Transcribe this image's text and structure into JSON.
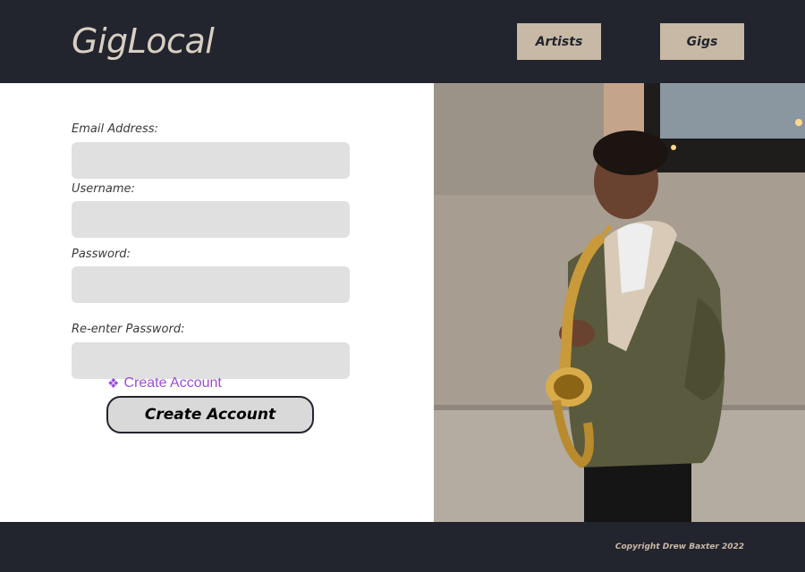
{
  "header": {
    "brand": "GigLocal",
    "nav": [
      {
        "label": "Artists"
      },
      {
        "label": "Gigs"
      }
    ]
  },
  "form": {
    "fields": [
      {
        "label": "Email Address:",
        "value": ""
      },
      {
        "label": "Username:",
        "value": ""
      },
      {
        "label": "Password:",
        "value": ""
      },
      {
        "label": "Re-enter Password:",
        "value": ""
      }
    ],
    "component_tag": "Create Account",
    "submit_label": "Create Account"
  },
  "footer": {
    "copyright": "Copyright Drew Baxter 2022"
  },
  "colors": {
    "dark": "#22242e",
    "accent": "#c7b9a5",
    "field": "#e0e0e0",
    "component_purple": "#9b4ddc"
  }
}
